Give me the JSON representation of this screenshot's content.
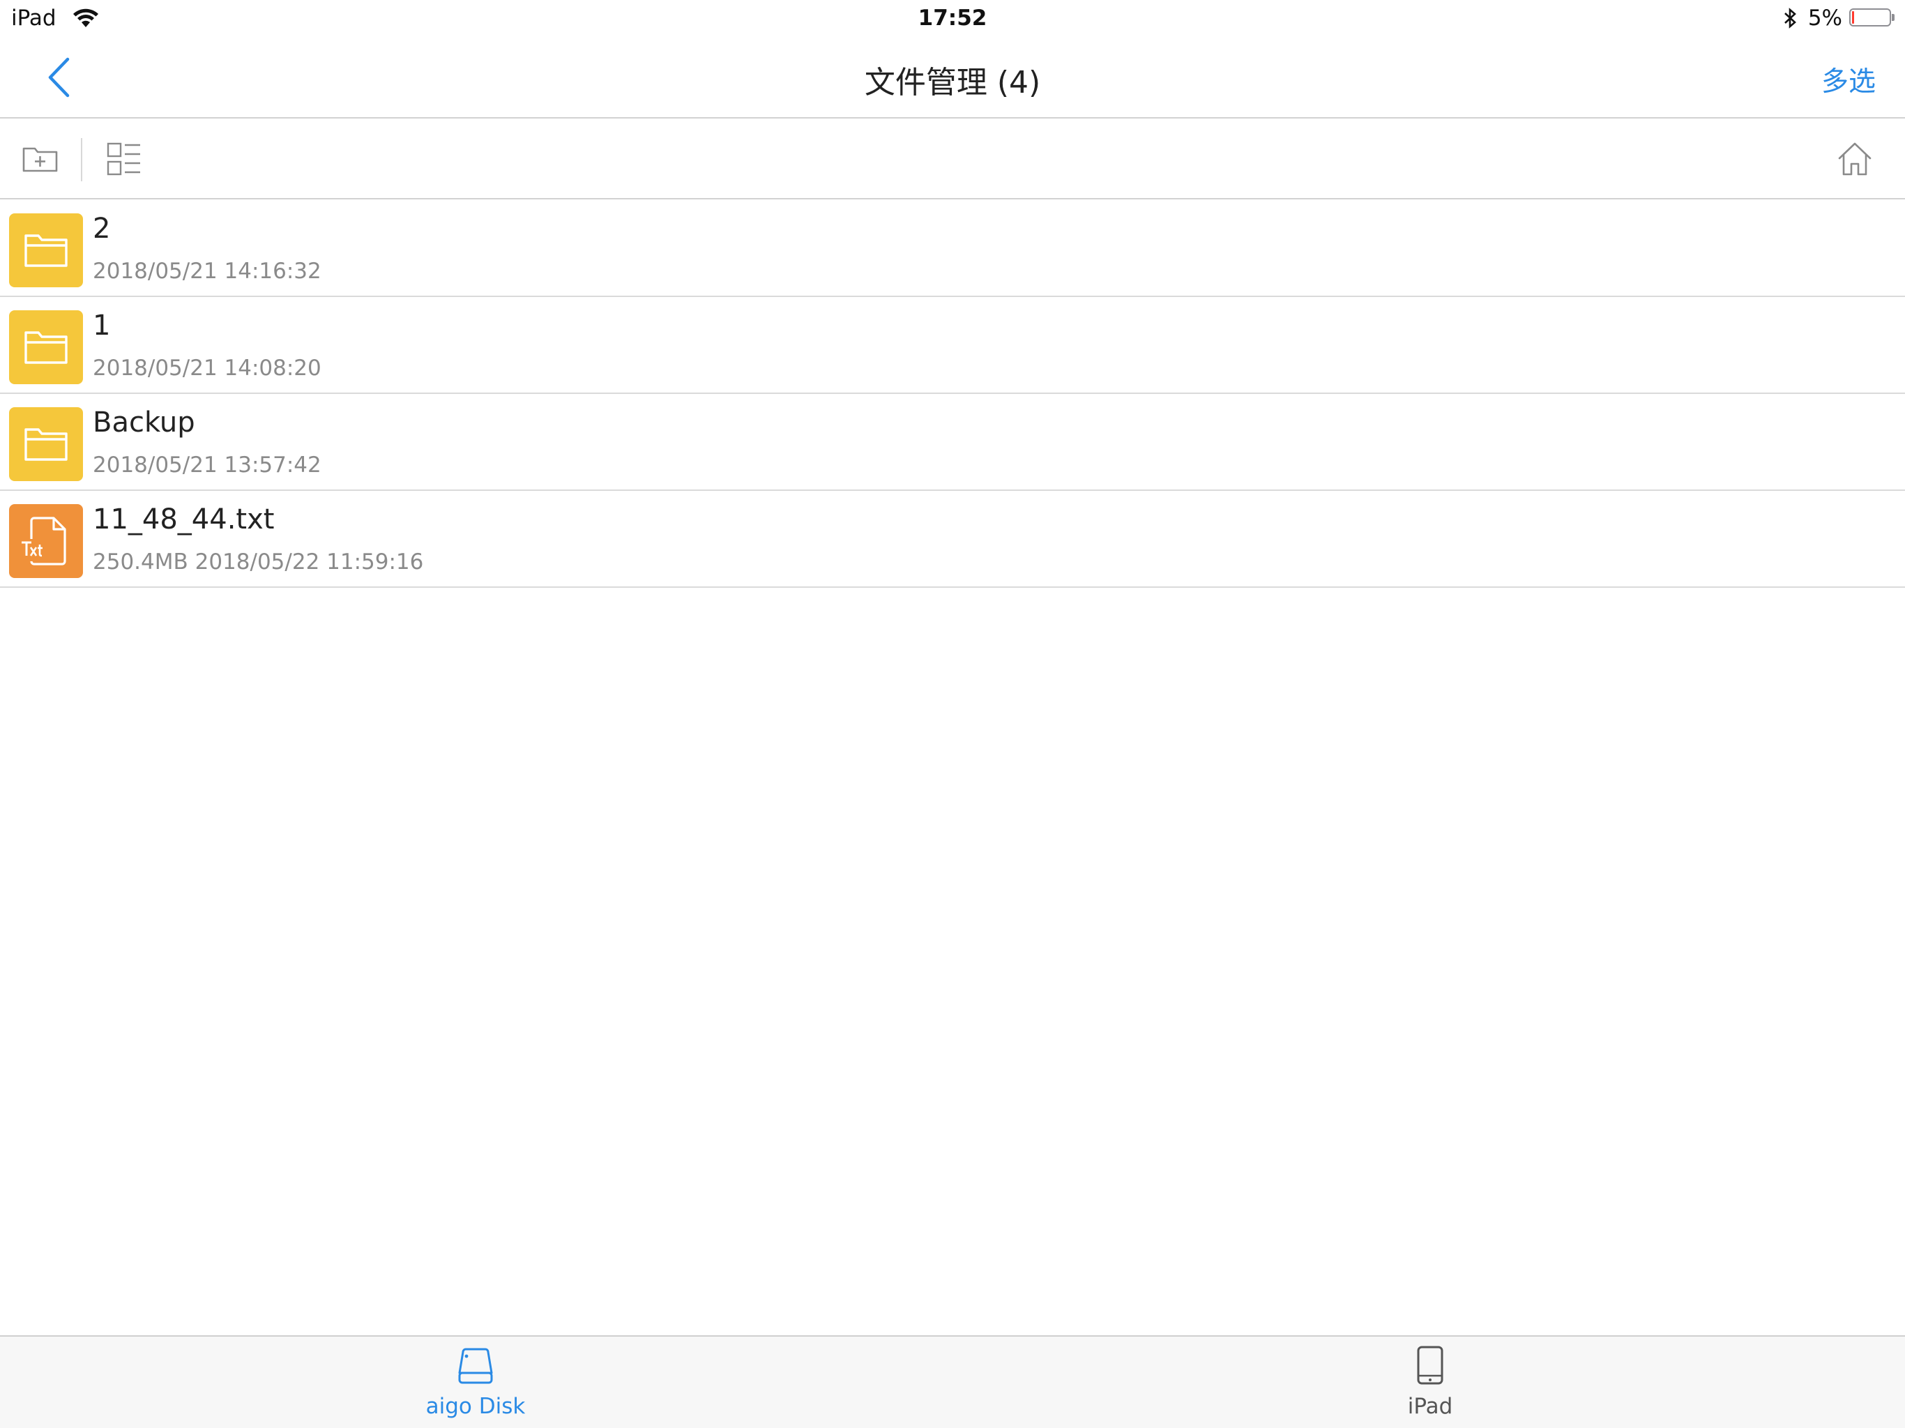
{
  "status_bar": {
    "device": "iPad",
    "time": "17:52",
    "battery_percent": "5%",
    "battery_level": 0.05
  },
  "nav": {
    "title": "文件管理 (4)",
    "multi_select_label": "多选",
    "accent_color": "#2a8ae5"
  },
  "toolbar": {
    "icons": [
      "new-folder-icon",
      "list-view-icon",
      "home-icon"
    ]
  },
  "files": [
    {
      "name": "2",
      "meta": "2018/05/21 14:16:32",
      "type": "folder"
    },
    {
      "name": "1",
      "meta": "2018/05/21 14:08:20",
      "type": "folder"
    },
    {
      "name": "Backup",
      "meta": "2018/05/21 13:57:42",
      "type": "folder"
    },
    {
      "name": "11_48_44.txt",
      "meta": "250.4MB 2018/05/22 11:59:16",
      "type": "txt"
    }
  ],
  "colors": {
    "folder": "#f5c73b",
    "txt_file": "#f0913a",
    "separator": "#dadada"
  },
  "tab_bar": {
    "tabs": [
      {
        "label": "aigo Disk",
        "icon": "disk-icon",
        "active": true
      },
      {
        "label": "iPad",
        "icon": "tablet-icon",
        "active": false
      }
    ]
  }
}
